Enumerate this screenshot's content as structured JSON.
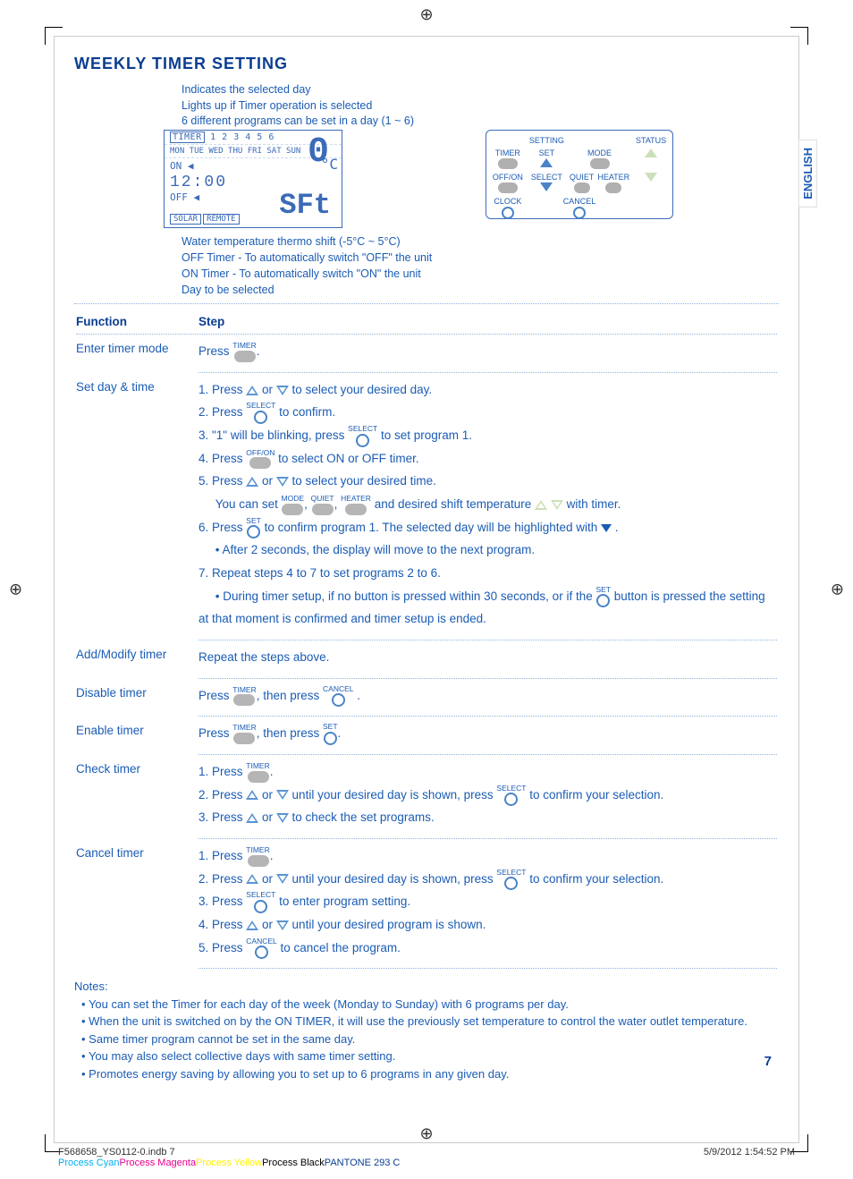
{
  "title": "WEEKLY TIMER SETTING",
  "language_tab": "ENGLISH",
  "page_number": "7",
  "top_callouts": [
    "Indicates the selected day",
    "Lights up if Timer operation is selected",
    "6 different programs can be set in a day (1 ~ 6)"
  ],
  "lcd": {
    "timer_label": "TIMER",
    "programs": "1 2 3 4 5 6",
    "days": "MON TUE WED THU FRI  SAT SUN",
    "on": "ON ◀",
    "off": "OFF ◀",
    "time": "12:00",
    "big_digit": "0",
    "unit": "°C",
    "sft": "SFt",
    "buttons": [
      "SOLAR",
      "REMOTE"
    ]
  },
  "remote": {
    "heading_setting": "SETTING",
    "heading_status": "STATUS",
    "labels": {
      "timer": "TIMER",
      "set": "SET",
      "mode": "MODE",
      "offon": "OFF/ON",
      "select": "SELECT",
      "quiet": "QUIET",
      "heater": "HEATER",
      "clock": "CLOCK",
      "cancel": "CANCEL"
    }
  },
  "bottom_callouts": [
    "Water temperature thermo shift (-5°C ~ 5°C)",
    "OFF Timer - To automatically switch \"OFF\" the unit",
    "ON Timer - To automatically switch \"ON\" the unit",
    "Day to be selected"
  ],
  "table": {
    "header": {
      "function": "Function",
      "step": "Step"
    },
    "rows": {
      "enter": {
        "fn": "Enter timer mode",
        "press": "Press",
        "period": "."
      },
      "setday": {
        "fn": "Set day & time",
        "s1a": "1.  Press ",
        "s1b": " or ",
        "s1c": " to select your desired day.",
        "s2a": "2.  Press ",
        "s2b": "  to confirm.",
        "s3a": "3.  \"1\" will be blinking, press ",
        "s3b": "  to set program 1.",
        "s4a": "4.  Press ",
        "s4b": " to select ON or OFF timer.",
        "s5a": "5.  Press ",
        "s5b": " or ",
        "s5c": " to select your desired time.",
        "s5d": "You can set ",
        "s5e": ", ",
        "s5f": ", ",
        "s5g": " and desired shift temperature ",
        "s5h": " with timer.",
        "s6a": "6.  Press ",
        "s6b": " to confirm program 1. The selected day will be highlighted with ",
        "s6c": " .",
        "s6d": "•  After 2 seconds, the display will move to the next program.",
        "s7": "7.  Repeat steps 4 to 7 to set programs 2 to 6.",
        "s7b": "•  During timer setup, if no button is pressed within 30 seconds, or if the ",
        "s7c": " button is pressed the setting at that moment is confirmed and timer setup is ended."
      },
      "addmod": {
        "fn": "Add/Modify timer",
        "txt": "Repeat the steps above."
      },
      "disable": {
        "fn": "Disable timer",
        "a": "Press ",
        "b": ", then press ",
        "c": " ."
      },
      "enable": {
        "fn": "Enable timer",
        "a": "Press ",
        "b": ", then press ",
        "c": "."
      },
      "check": {
        "fn": "Check timer",
        "s1": "1.  Press ",
        "s1b": ".",
        "s2a": "2. Press ",
        "s2b": " or ",
        "s2c": " until your desired day is shown, press ",
        "s2d": "  to confirm your selection.",
        "s3a": "3. Press ",
        "s3b": " or ",
        "s3c": " to check the set programs."
      },
      "cancel": {
        "fn": "Cancel timer",
        "s1": "1.  Press ",
        "s1b": ".",
        "s2a": "2. Press ",
        "s2b": " or ",
        "s2c": " until your desired day is shown, press ",
        "s2d": "  to confirm your selection.",
        "s3a": "3.  Press ",
        "s3b": "  to enter program setting.",
        "s4a": "4.  Press ",
        "s4b": " or ",
        "s4c": " until your desired program is shown.",
        "s5a": "5.  Press ",
        "s5b": "  to cancel the program."
      }
    }
  },
  "button_labels": {
    "timer": "TIMER",
    "select": "SELECT",
    "offon": "OFF/ON",
    "set": "SET",
    "cancel": "CANCEL",
    "mode": "MODE",
    "quiet": "QUIET",
    "heater": "HEATER"
  },
  "notes": {
    "heading": "Notes:",
    "items": [
      "You can set the Timer for each day of the week (Monday to Sunday) with 6 programs per day.",
      "When the unit is switched on by the ON TIMER, it will use the previously set temperature to control the water outlet temperature.",
      "Same timer program cannot be set in the same day.",
      "You may also select collective days with same timer setting.",
      "Promotes energy saving by allowing you to set up to 6 programs in any given day."
    ]
  },
  "footer": {
    "filename": "F568658_YS0112-0.indb   7",
    "datetime": "5/9/2012   1:54:52 PM",
    "colors": {
      "pc": "Process Cyan",
      "pm": "Process Magenta",
      "py": "Process Yellow",
      "pk": "Process Black",
      "p293": "PANTONE 293 C"
    }
  }
}
